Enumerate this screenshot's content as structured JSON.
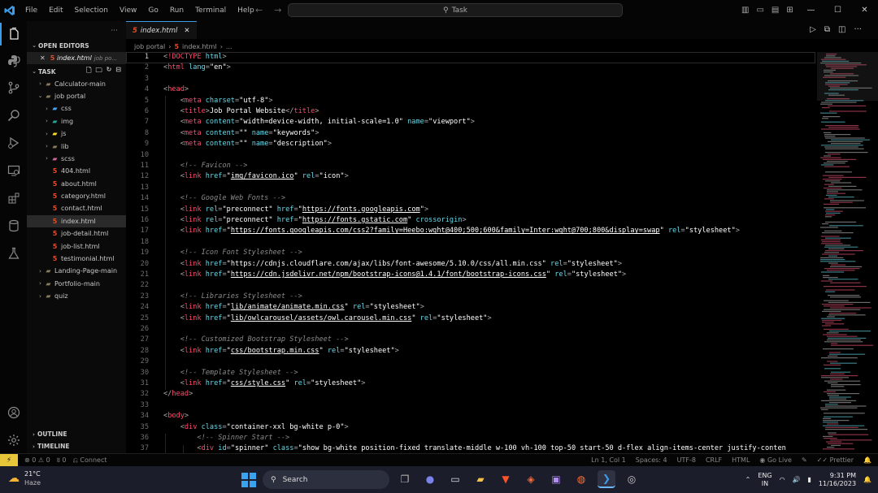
{
  "window": {
    "menu": [
      "File",
      "Edit",
      "Selection",
      "View",
      "Go",
      "Run",
      "Terminal",
      "Help"
    ],
    "search_label": "Task"
  },
  "sidebar": {
    "explorer_more": "···",
    "open_editors_label": "OPEN EDITORS",
    "open_editor": {
      "name": "index.html",
      "desc": "job po..."
    },
    "task_label": "TASK",
    "tree": [
      {
        "name": "Calculator-main",
        "type": "folder",
        "level": 1,
        "open": false
      },
      {
        "name": "job portal",
        "type": "folder",
        "level": 1,
        "open": true
      },
      {
        "name": "css",
        "type": "css-folder",
        "level": 2,
        "open": false
      },
      {
        "name": "img",
        "type": "img-folder",
        "level": 2,
        "open": false
      },
      {
        "name": "js",
        "type": "js-folder",
        "level": 2,
        "open": false
      },
      {
        "name": "lib",
        "type": "folder",
        "level": 2,
        "open": false
      },
      {
        "name": "scss",
        "type": "scss-folder",
        "level": 2,
        "open": false
      },
      {
        "name": "404.html",
        "type": "html",
        "level": 2
      },
      {
        "name": "about.html",
        "type": "html",
        "level": 2
      },
      {
        "name": "category.html",
        "type": "html",
        "level": 2
      },
      {
        "name": "contact.html",
        "type": "html",
        "level": 2
      },
      {
        "name": "index.html",
        "type": "html",
        "level": 2,
        "active": true
      },
      {
        "name": "job-detail.html",
        "type": "html",
        "level": 2
      },
      {
        "name": "job-list.html",
        "type": "html",
        "level": 2
      },
      {
        "name": "testimonial.html",
        "type": "html",
        "level": 2
      },
      {
        "name": "Landing-Page-main",
        "type": "folder",
        "level": 1,
        "open": false
      },
      {
        "name": "Portfolio-main",
        "type": "folder",
        "level": 1,
        "open": false
      },
      {
        "name": "quiz",
        "type": "folder",
        "level": 1,
        "open": false
      }
    ],
    "outline_label": "OUTLINE",
    "timeline_label": "TIMELINE"
  },
  "editor": {
    "tab_label": "index.html",
    "breadcrumb": [
      "job portal",
      "index.html",
      "..."
    ],
    "lines": [
      {
        "n": "1",
        "cur": true,
        "segs": [
          [
            "p",
            "<"
          ],
          [
            "t",
            "!DOCTYPE"
          ],
          [
            "a",
            " html"
          ],
          [
            "p",
            ">"
          ]
        ]
      },
      {
        "n": "2",
        "segs": [
          [
            "p",
            "<"
          ],
          [
            "t",
            "html"
          ],
          [
            "a",
            " lang"
          ],
          [
            "p",
            "="
          ],
          [
            "s",
            "\"en\""
          ],
          [
            "p",
            ">"
          ]
        ]
      },
      {
        "n": "3",
        "segs": []
      },
      {
        "n": "4",
        "segs": [
          [
            "p",
            "<"
          ],
          [
            "t",
            "head"
          ],
          [
            "p",
            ">"
          ]
        ]
      },
      {
        "n": "5",
        "segs": [
          [
            "p",
            "    <"
          ],
          [
            "t",
            "meta"
          ],
          [
            "a",
            " charset"
          ],
          [
            "p",
            "="
          ],
          [
            "s",
            "\"utf-8\""
          ],
          [
            "p",
            ">"
          ]
        ]
      },
      {
        "n": "6",
        "segs": [
          [
            "p",
            "    <"
          ],
          [
            "t",
            "title"
          ],
          [
            "p",
            ">"
          ],
          [
            "s",
            "Job Portal Website"
          ],
          [
            "p",
            "</"
          ],
          [
            "t",
            "title"
          ],
          [
            "p",
            ">"
          ]
        ]
      },
      {
        "n": "7",
        "segs": [
          [
            "p",
            "    <"
          ],
          [
            "t",
            "meta"
          ],
          [
            "a",
            " content"
          ],
          [
            "p",
            "="
          ],
          [
            "s",
            "\"width=device-width, initial-scale=1.0\""
          ],
          [
            "a",
            " name"
          ],
          [
            "p",
            "="
          ],
          [
            "s",
            "\"viewport\""
          ],
          [
            "p",
            ">"
          ]
        ]
      },
      {
        "n": "8",
        "segs": [
          [
            "p",
            "    <"
          ],
          [
            "t",
            "meta"
          ],
          [
            "a",
            " content"
          ],
          [
            "p",
            "="
          ],
          [
            "s",
            "\"\""
          ],
          [
            "a",
            " name"
          ],
          [
            "p",
            "="
          ],
          [
            "s",
            "\"keywords\""
          ],
          [
            "p",
            ">"
          ]
        ]
      },
      {
        "n": "9",
        "segs": [
          [
            "p",
            "    <"
          ],
          [
            "t",
            "meta"
          ],
          [
            "a",
            " content"
          ],
          [
            "p",
            "="
          ],
          [
            "s",
            "\"\""
          ],
          [
            "a",
            " name"
          ],
          [
            "p",
            "="
          ],
          [
            "s",
            "\"description\""
          ],
          [
            "p",
            ">"
          ]
        ]
      },
      {
        "n": "10",
        "segs": []
      },
      {
        "n": "11",
        "segs": [
          [
            "c",
            "    <!-- Favicon -->"
          ]
        ]
      },
      {
        "n": "12",
        "segs": [
          [
            "p",
            "    <"
          ],
          [
            "t",
            "link"
          ],
          [
            "a",
            " href"
          ],
          [
            "p",
            "="
          ],
          [
            "s",
            "\""
          ],
          [
            "su",
            "img/favicon.ico"
          ],
          [
            "s",
            "\""
          ],
          [
            "a",
            " rel"
          ],
          [
            "p",
            "="
          ],
          [
            "s",
            "\"icon\""
          ],
          [
            "p",
            ">"
          ]
        ]
      },
      {
        "n": "13",
        "segs": []
      },
      {
        "n": "14",
        "segs": [
          [
            "c",
            "    <!-- Google Web Fonts -->"
          ]
        ]
      },
      {
        "n": "15",
        "segs": [
          [
            "p",
            "    <"
          ],
          [
            "t",
            "link"
          ],
          [
            "a",
            " rel"
          ],
          [
            "p",
            "="
          ],
          [
            "s",
            "\"preconnect\""
          ],
          [
            "a",
            " href"
          ],
          [
            "p",
            "="
          ],
          [
            "s",
            "\""
          ],
          [
            "su",
            "https://fonts.googleapis.com"
          ],
          [
            "s",
            "\""
          ],
          [
            "p",
            ">"
          ]
        ]
      },
      {
        "n": "16",
        "segs": [
          [
            "p",
            "    <"
          ],
          [
            "t",
            "link"
          ],
          [
            "a",
            " rel"
          ],
          [
            "p",
            "="
          ],
          [
            "s",
            "\"preconnect\""
          ],
          [
            "a",
            " href"
          ],
          [
            "p",
            "="
          ],
          [
            "s",
            "\""
          ],
          [
            "su",
            "https://fonts.gstatic.com"
          ],
          [
            "s",
            "\""
          ],
          [
            "a",
            " crossorigin"
          ],
          [
            "p",
            ">"
          ]
        ]
      },
      {
        "n": "17",
        "segs": [
          [
            "p",
            "    <"
          ],
          [
            "t",
            "link"
          ],
          [
            "a",
            " href"
          ],
          [
            "p",
            "="
          ],
          [
            "s",
            "\""
          ],
          [
            "su",
            "https://fonts.googleapis.com/css2?family=Heebo:wght@400;500;600&family=Inter:wght@700;800&display=swap"
          ],
          [
            "s",
            "\""
          ],
          [
            "a",
            " rel"
          ],
          [
            "p",
            "="
          ],
          [
            "s",
            "\"stylesheet\""
          ],
          [
            "p",
            ">"
          ]
        ]
      },
      {
        "n": "18",
        "segs": []
      },
      {
        "n": "19",
        "segs": [
          [
            "c",
            "    <!-- Icon Font Stylesheet -->"
          ]
        ]
      },
      {
        "n": "20",
        "segs": [
          [
            "p",
            "    <"
          ],
          [
            "t",
            "link"
          ],
          [
            "a",
            " href"
          ],
          [
            "p",
            "="
          ],
          [
            "s",
            "\"https://cdnjs.cloudflare.com/ajax/libs/font-awesome/5.10.0/css/all.min.css\""
          ],
          [
            "a",
            " rel"
          ],
          [
            "p",
            "="
          ],
          [
            "s",
            "\"stylesheet\""
          ],
          [
            "p",
            ">"
          ]
        ]
      },
      {
        "n": "21",
        "segs": [
          [
            "p",
            "    <"
          ],
          [
            "t",
            "link"
          ],
          [
            "a",
            " href"
          ],
          [
            "p",
            "="
          ],
          [
            "s",
            "\""
          ],
          [
            "su",
            "https://cdn.jsdelivr.net/npm/bootstrap-icons@1.4.1/font/bootstrap-icons.css"
          ],
          [
            "s",
            "\""
          ],
          [
            "a",
            " rel"
          ],
          [
            "p",
            "="
          ],
          [
            "s",
            "\"stylesheet\""
          ],
          [
            "p",
            ">"
          ]
        ]
      },
      {
        "n": "22",
        "segs": []
      },
      {
        "n": "23",
        "segs": [
          [
            "c",
            "    <!-- Libraries Stylesheet -->"
          ]
        ]
      },
      {
        "n": "24",
        "segs": [
          [
            "p",
            "    <"
          ],
          [
            "t",
            "link"
          ],
          [
            "a",
            " href"
          ],
          [
            "p",
            "="
          ],
          [
            "s",
            "\""
          ],
          [
            "su",
            "lib/animate/animate.min.css"
          ],
          [
            "s",
            "\""
          ],
          [
            "a",
            " rel"
          ],
          [
            "p",
            "="
          ],
          [
            "s",
            "\"stylesheet\""
          ],
          [
            "p",
            ">"
          ]
        ]
      },
      {
        "n": "25",
        "segs": [
          [
            "p",
            "    <"
          ],
          [
            "t",
            "link"
          ],
          [
            "a",
            " href"
          ],
          [
            "p",
            "="
          ],
          [
            "s",
            "\""
          ],
          [
            "su",
            "lib/owlcarousel/assets/owl.carousel.min.css"
          ],
          [
            "s",
            "\""
          ],
          [
            "a",
            " rel"
          ],
          [
            "p",
            "="
          ],
          [
            "s",
            "\"stylesheet\""
          ],
          [
            "p",
            ">"
          ]
        ]
      },
      {
        "n": "26",
        "segs": []
      },
      {
        "n": "27",
        "segs": [
          [
            "c",
            "    <!-- Customized Bootstrap Stylesheet -->"
          ]
        ]
      },
      {
        "n": "28",
        "segs": [
          [
            "p",
            "    <"
          ],
          [
            "t",
            "link"
          ],
          [
            "a",
            " href"
          ],
          [
            "p",
            "="
          ],
          [
            "s",
            "\""
          ],
          [
            "su",
            "css/bootstrap.min.css"
          ],
          [
            "s",
            "\""
          ],
          [
            "a",
            " rel"
          ],
          [
            "p",
            "="
          ],
          [
            "s",
            "\"stylesheet\""
          ],
          [
            "p",
            ">"
          ]
        ]
      },
      {
        "n": "29",
        "segs": []
      },
      {
        "n": "30",
        "segs": [
          [
            "c",
            "    <!-- Template Stylesheet -->"
          ]
        ]
      },
      {
        "n": "31",
        "segs": [
          [
            "p",
            "    <"
          ],
          [
            "t",
            "link"
          ],
          [
            "a",
            " href"
          ],
          [
            "p",
            "="
          ],
          [
            "s",
            "\""
          ],
          [
            "su",
            "css/style.css"
          ],
          [
            "s",
            "\""
          ],
          [
            "a",
            " rel"
          ],
          [
            "p",
            "="
          ],
          [
            "s",
            "\"stylesheet\""
          ],
          [
            "p",
            ">"
          ]
        ]
      },
      {
        "n": "32",
        "segs": [
          [
            "p",
            "</"
          ],
          [
            "t",
            "head"
          ],
          [
            "p",
            ">"
          ]
        ]
      },
      {
        "n": "33",
        "segs": []
      },
      {
        "n": "34",
        "segs": [
          [
            "p",
            "<"
          ],
          [
            "t",
            "body"
          ],
          [
            "p",
            ">"
          ]
        ]
      },
      {
        "n": "35",
        "segs": [
          [
            "p",
            "    <"
          ],
          [
            "t",
            "div"
          ],
          [
            "a",
            " class"
          ],
          [
            "p",
            "="
          ],
          [
            "s",
            "\"container-xxl bg-white p-0\""
          ],
          [
            "p",
            ">"
          ]
        ]
      },
      {
        "n": "36",
        "segs": [
          [
            "c",
            "        <!-- Spinner Start -->"
          ]
        ]
      },
      {
        "n": "37",
        "segs": [
          [
            "p",
            "        <"
          ],
          [
            "t",
            "div"
          ],
          [
            "a",
            " id"
          ],
          [
            "p",
            "="
          ],
          [
            "s",
            "\"spinner\""
          ],
          [
            "a",
            " class"
          ],
          [
            "p",
            "="
          ],
          [
            "s",
            "\"show bg-white position-fixed translate-middle w-100 vh-100 top-50 start-50 d-flex align-items-center justify-conten"
          ]
        ]
      }
    ]
  },
  "statusbar": {
    "errors": "0",
    "warnings": "0",
    "ports": "0",
    "connect": "Connect",
    "position": "Ln 1, Col 1",
    "spaces": "Spaces: 4",
    "encoding": "UTF-8",
    "eol": "CRLF",
    "language": "HTML",
    "golive": "Go Live",
    "prettier": "Prettier"
  },
  "taskbar": {
    "temp": "21°C",
    "weather": "Haze",
    "search_label": "Search",
    "lang_top": "ENG",
    "lang_bottom": "IN",
    "time": "9:31 PM",
    "date": "11/16/2023"
  },
  "colors": {
    "accent": "#3c9be8",
    "tag": "#ff4b6e",
    "attr": "#66d9e8",
    "remote": "#e8c63a"
  }
}
